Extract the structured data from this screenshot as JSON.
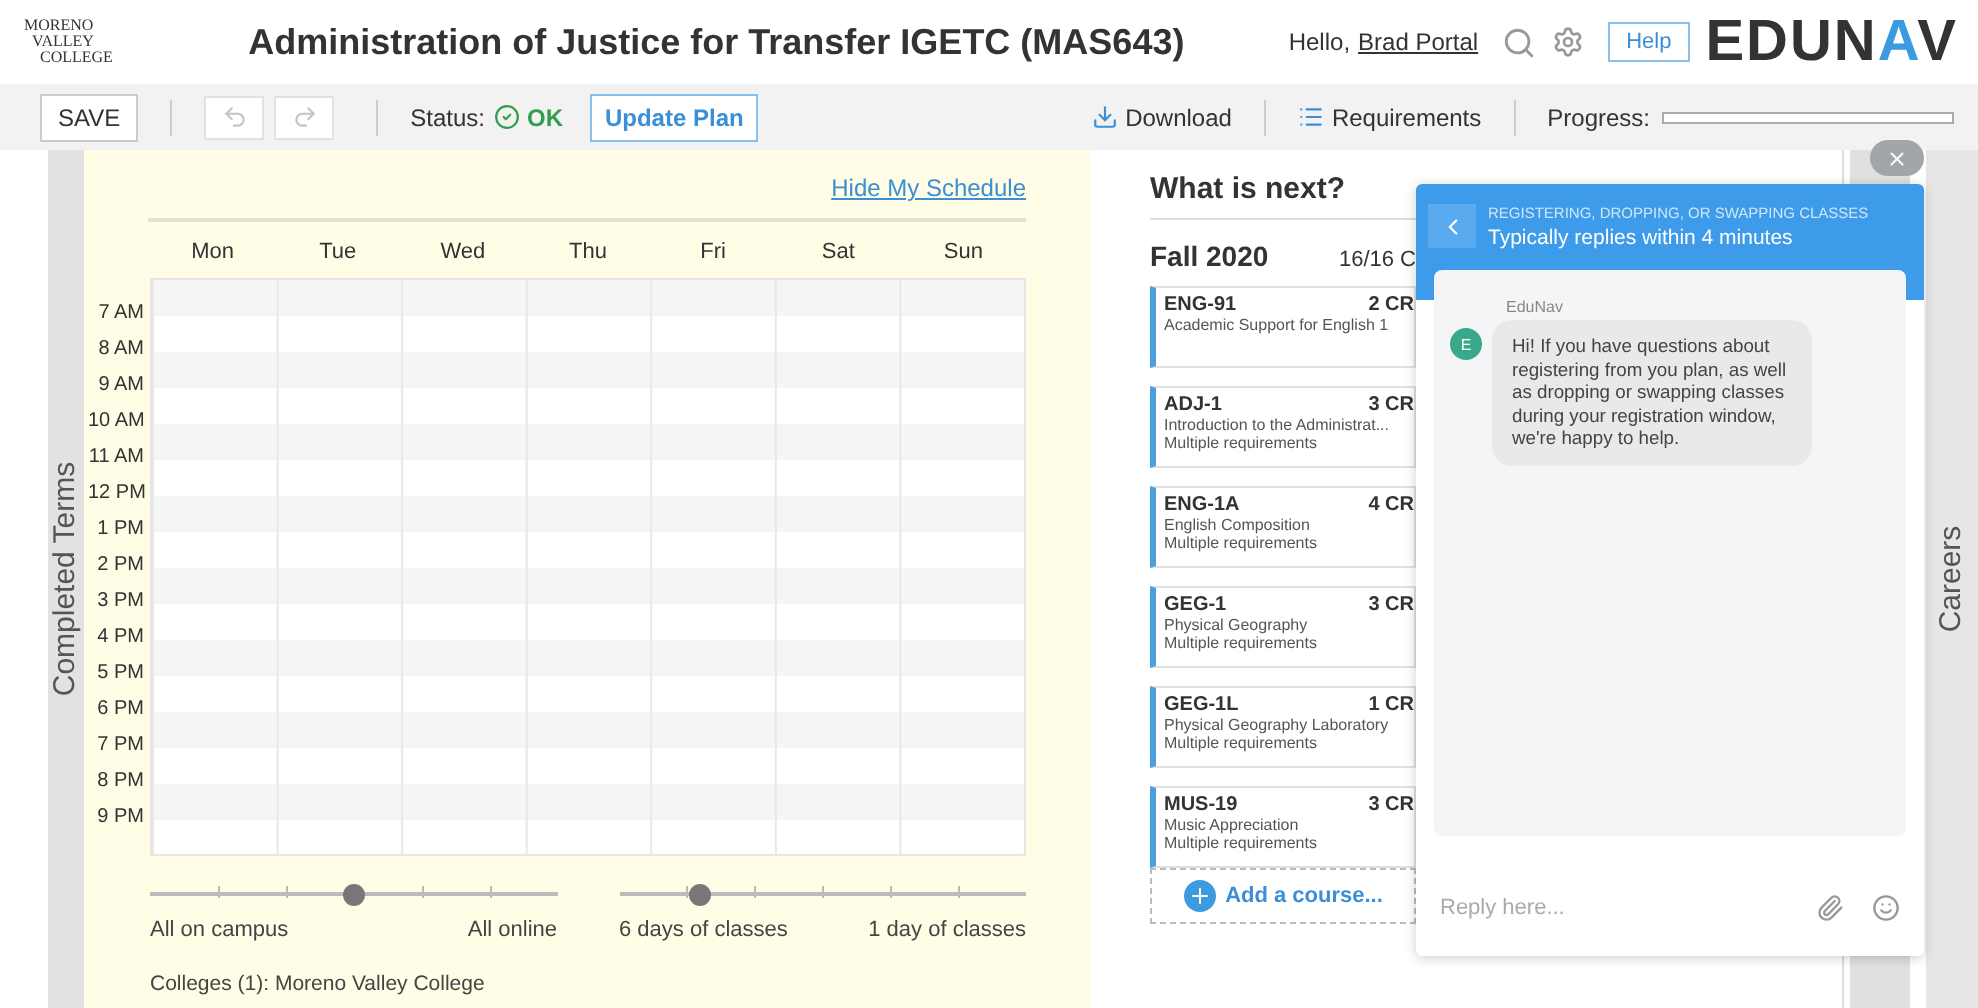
{
  "header": {
    "logo_lines": [
      "MORENO",
      "VALLEY",
      "COLLEGE"
    ],
    "title": "Administration of Justice for Transfer IGETC (MAS643)",
    "greeting": "Hello,",
    "user": "Brad Portal",
    "help": "Help",
    "brand": {
      "before": "EDUN",
      "accent": "A",
      "after": "V"
    }
  },
  "toolbar": {
    "save": "SAVE",
    "undo_disabled": true,
    "redo_disabled": true,
    "status_label": "Status:",
    "status_value": "OK",
    "update": "Update Plan",
    "download": "Download",
    "requirements": "Requirements",
    "progress_label": "Progress:",
    "progress": {
      "level": 0
    }
  },
  "side_labels": {
    "left": "Completed Terms",
    "right": "Careers"
  },
  "schedule": {
    "hide_link": "Hide My Schedule",
    "days": [
      "Mon",
      "Tue",
      "Wed",
      "Thu",
      "Fri",
      "Sat",
      "Sun"
    ],
    "times": [
      "7 AM",
      "8 AM",
      "9 AM",
      "10 AM",
      "11 AM",
      "12 PM",
      "1 PM",
      "2 PM",
      "3 PM",
      "4 PM",
      "5 PM",
      "6 PM",
      "7 PM",
      "8 PM",
      "9 PM"
    ],
    "sliders": [
      {
        "level": 0.5,
        "left_label": "All on campus",
        "right_label": "All online"
      },
      {
        "level": 0.2,
        "left_label": "6 days of classes",
        "right_label": "1 day of classes"
      }
    ],
    "colleges": "Colleges (1): Moreno Valley College"
  },
  "next": {
    "title": "What is next?",
    "term": "Fall 2020",
    "credits": "16/16 C",
    "courses": [
      {
        "code": "ENG-91",
        "credits": "2 CR",
        "name": "Academic Support for English 1"
      },
      {
        "code": "ADJ-1",
        "credits": "3 CR",
        "name": "Introduction to the Administrat...",
        "requirement": "Multiple requirements"
      },
      {
        "code": "ENG-1A",
        "credits": "4 CR",
        "name": "English Composition",
        "requirement": "Multiple requirements"
      },
      {
        "code": "GEG-1",
        "credits": "3 CR",
        "name": "Physical Geography",
        "requirement": "Multiple requirements"
      },
      {
        "code": "GEG-1L",
        "credits": "1 CR",
        "name": "Physical Geography Laboratory",
        "requirement": "Multiple requirements"
      },
      {
        "code": "MUS-19",
        "credits": "3 CR",
        "name": "Music Appreciation",
        "requirement": "Multiple requirements"
      }
    ],
    "add": "Add a course..."
  },
  "chat": {
    "topic": "REGISTERING, DROPPING, OR SWAPPING CLASSES",
    "subtitle": "Typically replies within 4 minutes",
    "sender": "EduNav",
    "avatar": "E",
    "message": "Hi! If you have questions about registering from you plan, as well as dropping or swapping classes during your registration window, we're happy to help.",
    "placeholder": "Reply here..."
  }
}
